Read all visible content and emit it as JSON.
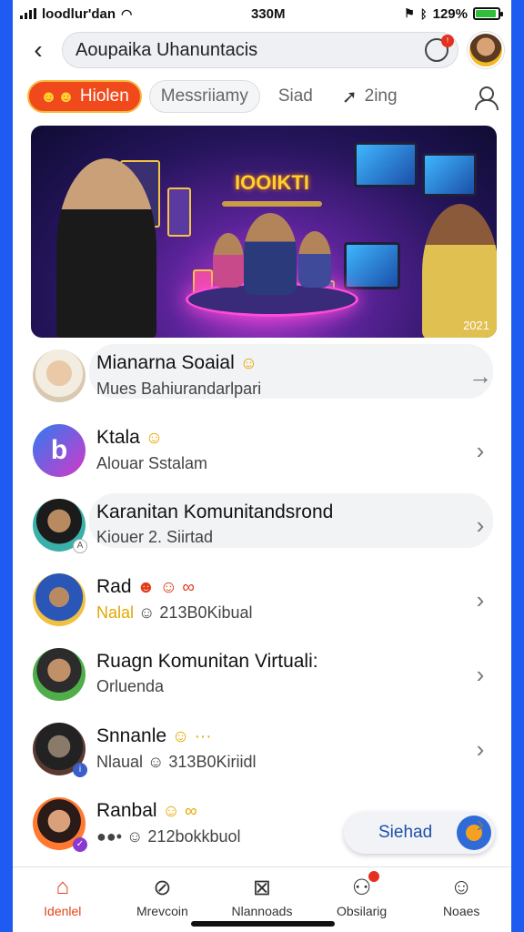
{
  "status_bar": {
    "carrier": "loodlur'dan",
    "time": "330M",
    "battery": "129%",
    "battery_level": 0.9
  },
  "header": {
    "back_icon": "chevron-left-icon",
    "search_text": "Aoupaika Uhanuntacis",
    "notification_badge": "!"
  },
  "tabs": [
    {
      "label": "Hiolen",
      "emoji": "☻☻",
      "active": true
    },
    {
      "label": "Messriiamy",
      "active": false
    },
    {
      "label": "Siad",
      "active": false
    },
    {
      "label": "2ing",
      "icon": "send-icon",
      "active": false
    }
  ],
  "banner": {
    "title": "IOOIKTI",
    "year": "2021"
  },
  "list": [
    {
      "title": "Mianarna Soaial",
      "emoji": "☺",
      "subtitle": "Mues Bahiurandarlpari",
      "chevron": "→",
      "highlight": true
    },
    {
      "title": "Ktala",
      "emoji": "☺",
      "subtitle": "Alouar Sstalam",
      "chevron": "›",
      "highlight": false
    },
    {
      "title": "Karanitan Komunitandsrond",
      "emoji": "",
      "subtitle": "Kiouer 2. Siirtad",
      "chevron": "›",
      "highlight": true
    },
    {
      "title": "Rad",
      "emoji": "☻ ☺ ∞",
      "subtitle_accent": "Nalal",
      "subtitle": "☺ 213B0Kibual",
      "chevron": "›",
      "highlight": false
    },
    {
      "title": "Ruagn Komunitan Virtuali:",
      "emoji": "",
      "subtitle": "Orluenda",
      "chevron": "›",
      "highlight": false
    },
    {
      "title": "Snnanle",
      "emoji": "☺ ···",
      "subtitle": "Nlaual ☺ 313B0Kiriidl",
      "chevron": "›",
      "highlight": false
    },
    {
      "title": "Ranbal",
      "emoji": "☺ ∞",
      "subtitle": "●●• ☺ 212bokkbuol",
      "chevron": "›",
      "highlight": false
    }
  ],
  "fab": {
    "label": "Siehad"
  },
  "bottom_nav": [
    {
      "label": "Idenlel",
      "icon": "home-icon",
      "active": true
    },
    {
      "label": "Mrevcoin",
      "icon": "explore-icon",
      "active": false
    },
    {
      "label": "Nlannoads",
      "icon": "create-icon",
      "active": false
    },
    {
      "label": "Obsilarig",
      "icon": "friends-icon",
      "active": false,
      "dot": true
    },
    {
      "label": "Noaes",
      "icon": "profile-icon",
      "active": false
    }
  ],
  "colors": {
    "accent": "#f04a1c",
    "frame": "#1e5bf0",
    "link": "#1f4fa8"
  }
}
